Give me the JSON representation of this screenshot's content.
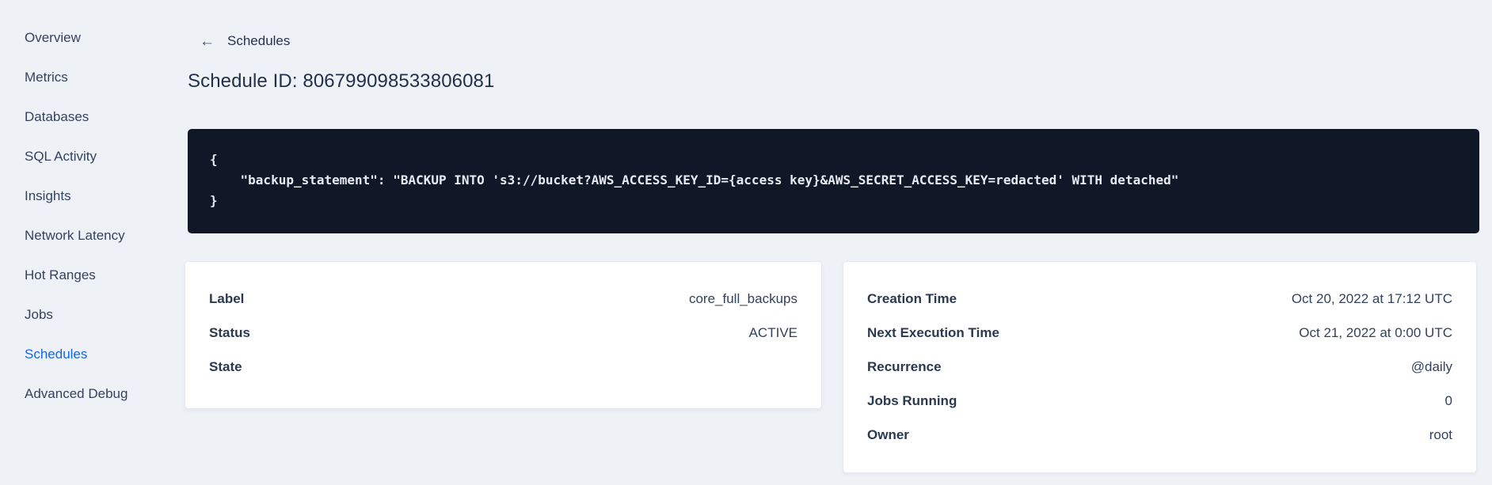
{
  "sidebar": {
    "items": [
      {
        "label": "Overview"
      },
      {
        "label": "Metrics"
      },
      {
        "label": "Databases"
      },
      {
        "label": "SQL Activity"
      },
      {
        "label": "Insights"
      },
      {
        "label": "Network Latency"
      },
      {
        "label": "Hot Ranges"
      },
      {
        "label": "Jobs"
      },
      {
        "label": "Schedules"
      },
      {
        "label": "Advanced Debug"
      }
    ],
    "active_item": "Schedules"
  },
  "header": {
    "back_icon": "←",
    "back_label": "Schedules",
    "title": "Schedule ID: 806799098533806081"
  },
  "code_block": {
    "lines": [
      "{",
      "    \"backup_statement\": \"BACKUP INTO 's3://bucket?AWS_ACCESS_KEY_ID={access key}&AWS_SECRET_ACCESS_KEY=redacted' WITH detached\"",
      "}"
    ]
  },
  "summary_left": {
    "rows": [
      {
        "label": "Label",
        "value": "core_full_backups"
      },
      {
        "label": "Status",
        "value": "ACTIVE"
      },
      {
        "label": "State",
        "value": ""
      }
    ]
  },
  "summary_right": {
    "rows": [
      {
        "label": "Creation Time",
        "value": "Oct 20, 2022 at 17:12 UTC"
      },
      {
        "label": "Next Execution Time",
        "value": "Oct 21, 2022 at 0:00 UTC"
      },
      {
        "label": "Recurrence",
        "value": "@daily"
      },
      {
        "label": "Jobs Running",
        "value": "0"
      },
      {
        "label": "Owner",
        "value": "root"
      }
    ]
  },
  "colors": {
    "page_bg": "#eef2f7",
    "accent_blue": "#1567e8",
    "code_bg": "#101726",
    "card_bg": "#ffffff"
  }
}
